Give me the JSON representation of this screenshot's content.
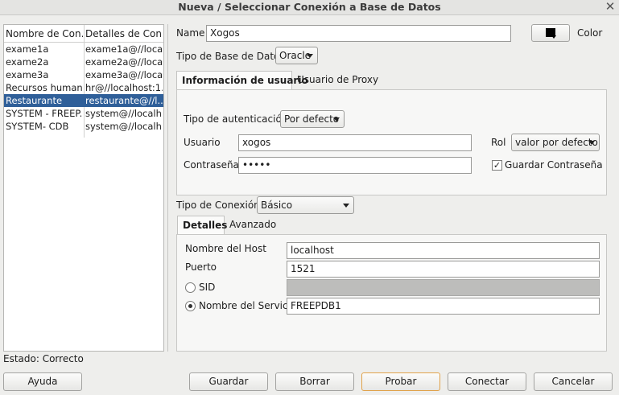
{
  "window": {
    "title": "Nueva / Seleccionar Conexión a Base de Datos"
  },
  "connections": {
    "headers": [
      "Nombre de Con...",
      "Detalles de Con..."
    ],
    "rows": [
      {
        "name": "exame1a",
        "details": "exame1a@//loca..."
      },
      {
        "name": "exame2a",
        "details": "exame2a@//loca..."
      },
      {
        "name": "exame3a",
        "details": "exame3a@//loca..."
      },
      {
        "name": "Recursos human...",
        "details": "hr@//localhost:1..."
      },
      {
        "name": "Restaurante",
        "details": "restaurante@//l...",
        "selected": true
      },
      {
        "name": "SYSTEM - FREEP...",
        "details": "system@//localh..."
      },
      {
        "name": "SYSTEM- CDB",
        "details": "system@//localh..."
      }
    ]
  },
  "form": {
    "name_label": "Name",
    "name_value": "Xogos",
    "color_label": "Color",
    "db_type_label": "Tipo de Base de Datos",
    "db_type_value": "Oracle",
    "tabs": [
      "Información de usuario",
      "Usuario de Proxy"
    ],
    "auth_label": "Tipo de autenticación",
    "auth_value": "Por defecto",
    "user_label": "Usuario",
    "user_value": "xogos",
    "role_label": "Rol",
    "role_value": "valor por defecto",
    "password_label": "Contraseña",
    "password_value": "•••••",
    "save_password_label": "Guardar Contraseña",
    "save_password_checked": true,
    "conn_type_label": "Tipo de Conexión",
    "conn_type_value": "Básico",
    "conn_tabs": [
      "Detalles",
      "Avanzado"
    ],
    "host_label": "Nombre del Host",
    "host_value": "localhost",
    "port_label": "Puerto",
    "port_value": "1521",
    "sid_label": "SID",
    "sid_value": "",
    "service_label": "Nombre del Servicio",
    "service_value": "FREEPDB1"
  },
  "status": "Estado: Correcto",
  "buttons": {
    "help": "Ayuda",
    "save": "Guardar",
    "delete": "Borrar",
    "test": "Probar",
    "connect": "Conectar",
    "cancel": "Cancelar"
  }
}
